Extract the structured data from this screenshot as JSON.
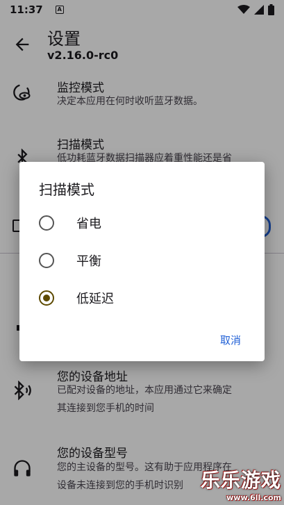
{
  "status_bar": {
    "time": "11:37",
    "notification_letter": "A"
  },
  "header": {
    "title": "设置",
    "version": "v2.16.0-rc0"
  },
  "prefs": [
    {
      "title": "监控模式",
      "summary": "决定本应用在何时收听蓝牙数据。"
    },
    {
      "title": "扫描模式",
      "summary": "低功耗蓝牙数据扫描器应着重性能还是省"
    },
    {
      "title": "您的设备地址",
      "summary_line1": "已配对设备的地址，本应用通过它来确定",
      "summary_line2": "其连接到您手机的时间"
    },
    {
      "title": "您的设备型号",
      "summary_line1": "您的主设备的型号。这有助于应用程序在",
      "summary_line2": "设备未连接到您的手机时识别"
    }
  ],
  "dialog": {
    "title": "扫描模式",
    "options": [
      {
        "label": "省电",
        "checked": false
      },
      {
        "label": "平衡",
        "checked": false
      },
      {
        "label": "低延迟",
        "checked": true
      }
    ],
    "cancel_label": "取消"
  },
  "watermark": {
    "name": "乐乐游戏",
    "url": "www.6ll.com"
  },
  "colors": {
    "accent": "#1f5fd6",
    "radio_checked": "#5d4a00"
  }
}
